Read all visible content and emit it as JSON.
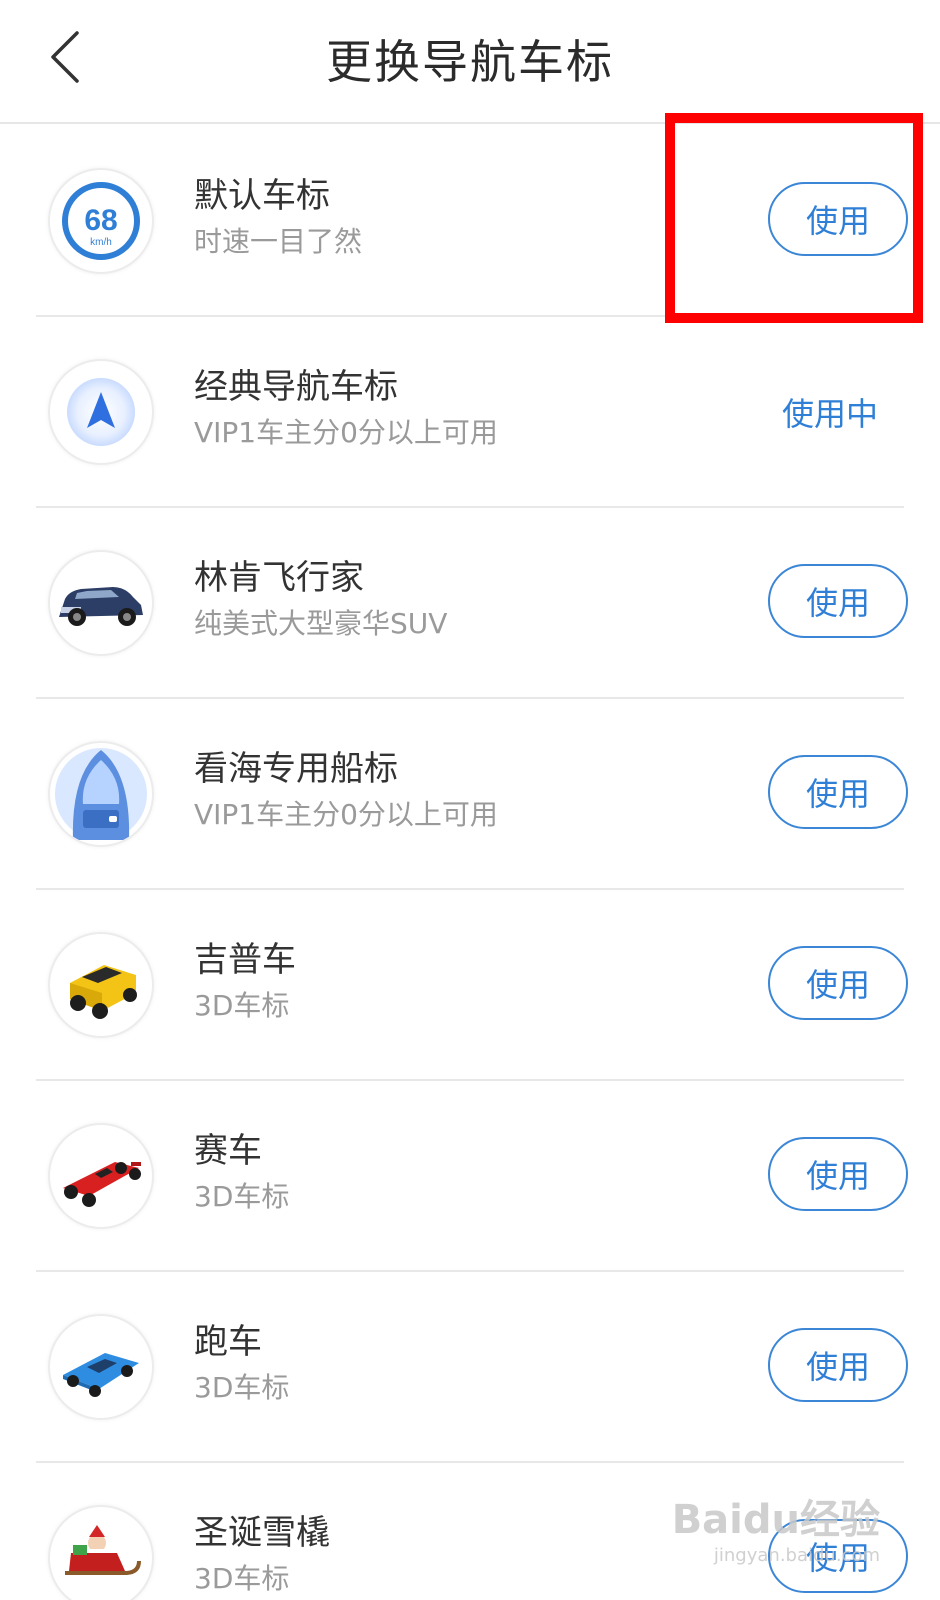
{
  "header": {
    "title": "更换导航车标",
    "back_icon": "chevron-left-icon"
  },
  "colors": {
    "accent": "#2f7fd6",
    "highlight": "#ff0000",
    "divider": "#e8e8e8",
    "subtitle": "#9a9a9a"
  },
  "items": [
    {
      "name": "默认车标",
      "desc": "时速一目了然",
      "action": "使用",
      "icon": "speed-68-icon",
      "speed_value": "68",
      "speed_unit": "km/h"
    },
    {
      "name": "经典导航车标",
      "desc": "VIP1车主分0分以上可用",
      "action": "使用中",
      "icon": "navigation-arrow-icon"
    },
    {
      "name": "林肯飞行家",
      "desc": "纯美式大型豪华SUV",
      "action": "使用",
      "icon": "suv-icon"
    },
    {
      "name": "看海专用船标",
      "desc": "VIP1车主分0分以上可用",
      "action": "使用",
      "icon": "boat-icon"
    },
    {
      "name": "吉普车",
      "desc": "3D车标",
      "action": "使用",
      "icon": "jeep-icon"
    },
    {
      "name": "赛车",
      "desc": "3D车标",
      "action": "使用",
      "icon": "race-car-icon"
    },
    {
      "name": "跑车",
      "desc": "3D车标",
      "action": "使用",
      "icon": "sports-car-icon"
    },
    {
      "name": "圣诞雪橇",
      "desc": "3D车标",
      "action": "使用",
      "icon": "sleigh-icon"
    }
  ],
  "watermark": {
    "text": "Baidu经验",
    "sub": "jingyan.baidu.com"
  }
}
